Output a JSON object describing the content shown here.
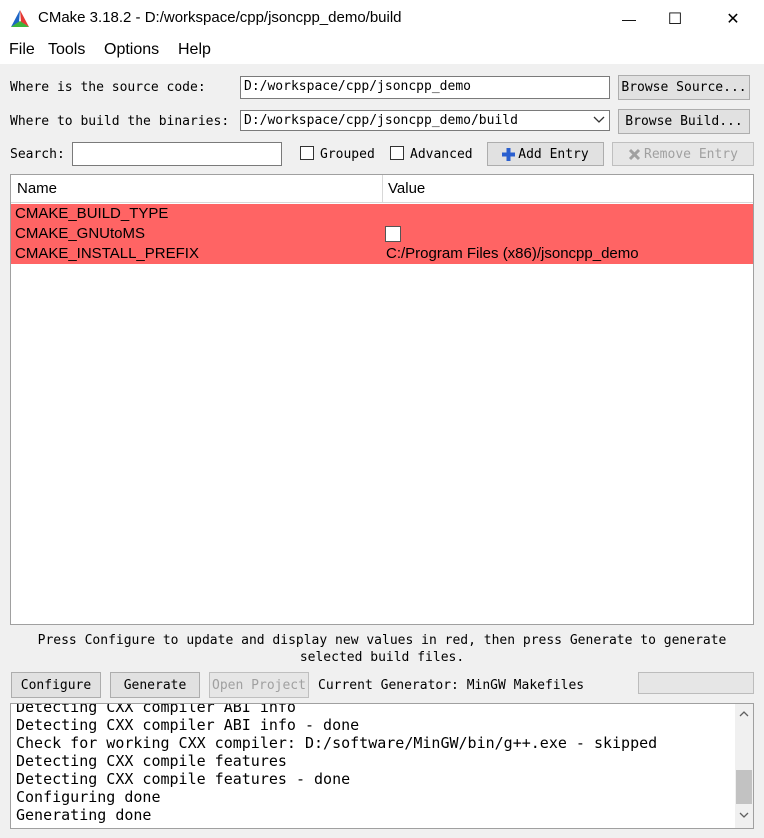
{
  "window": {
    "title": "CMake 3.18.2 - D:/workspace/cpp/jsoncpp_demo/build",
    "minimize_glyph": "—",
    "maximize_glyph": "☐",
    "close_glyph": "✕"
  },
  "menu": [
    "File",
    "Tools",
    "Options",
    "Help"
  ],
  "source": {
    "label": "Where is the source code:",
    "value": "D:/workspace/cpp/jsoncpp_demo",
    "browse_label": "Browse Source..."
  },
  "build": {
    "label": "Where to build the binaries:",
    "value": "D:/workspace/cpp/jsoncpp_demo/build",
    "browse_label": "Browse Build..."
  },
  "search": {
    "label": "Search:",
    "value": "",
    "grouped_label": "Grouped",
    "grouped_checked": false,
    "advanced_label": "Advanced",
    "advanced_checked": false,
    "add_entry_label": "Add Entry",
    "remove_entry_label": "Remove Entry"
  },
  "table": {
    "columns": [
      "Name",
      "Value"
    ],
    "rows": [
      {
        "name": "CMAKE_BUILD_TYPE",
        "value": ""
      },
      {
        "name": "CMAKE_GNUtoMS",
        "value": ""
      },
      {
        "name": "CMAKE_INSTALL_PREFIX",
        "value": "C:/Program Files (x86)/jsoncpp_demo"
      }
    ],
    "highlight_color": "#ff6464"
  },
  "hint": {
    "line1": "Press Configure to update and display new values in red, then press Generate to generate",
    "line2": "selected build files."
  },
  "actions": {
    "configure_label": "Configure",
    "generate_label": "Generate",
    "open_project_label": "Open Project",
    "generator_text": "Current Generator: MinGW Makefiles"
  },
  "output": {
    "lines": [
      "Detecting CXX compiler ABI info",
      "Detecting CXX compiler ABI info - done",
      "Check for working CXX compiler: D:/software/MinGW/bin/g++.exe - skipped",
      "Detecting CXX compile features",
      "Detecting CXX compile features - done",
      "Configuring done",
      "Generating done"
    ]
  },
  "icons": {
    "logo": "cmake-logo-icon",
    "add": "plus-icon",
    "remove": "cross-icon"
  }
}
